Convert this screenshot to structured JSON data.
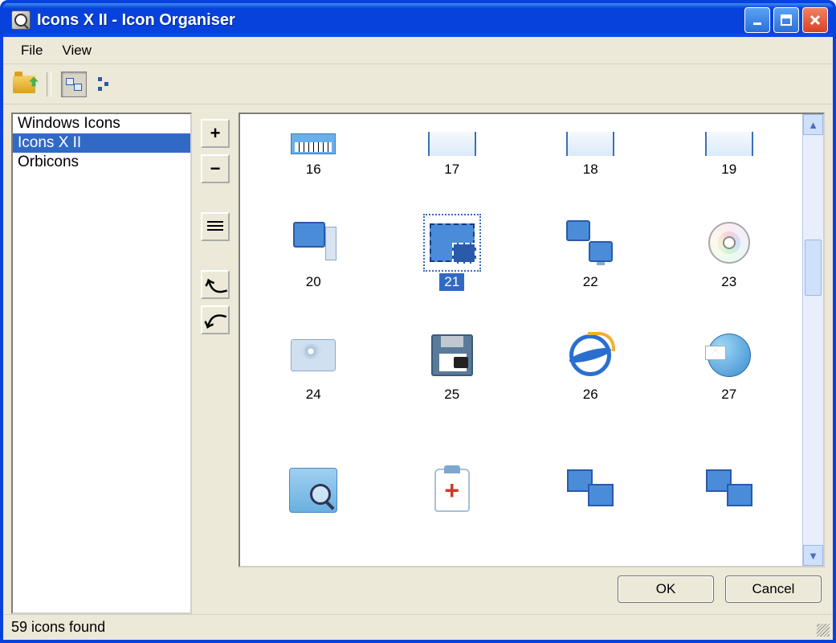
{
  "window": {
    "title": "Icons X II - Icon Organiser"
  },
  "menu": {
    "file": "File",
    "view": "View"
  },
  "sidebar": {
    "items": [
      {
        "label": "Windows Icons"
      },
      {
        "label": "Icons X II"
      },
      {
        "label": "Orbicons"
      }
    ],
    "selected_index": 1
  },
  "grid": {
    "selected_index": 5,
    "icons": [
      {
        "label": "16",
        "kind": "piano"
      },
      {
        "label": "17",
        "kind": "monitor"
      },
      {
        "label": "18",
        "kind": "monitor"
      },
      {
        "label": "19",
        "kind": "monitor"
      },
      {
        "label": "20",
        "kind": "computer"
      },
      {
        "label": "21",
        "kind": "network-selected"
      },
      {
        "label": "22",
        "kind": "network"
      },
      {
        "label": "23",
        "kind": "disc"
      },
      {
        "label": "24",
        "kind": "drive"
      },
      {
        "label": "25",
        "kind": "floppy"
      },
      {
        "label": "26",
        "kind": "ie"
      },
      {
        "label": "27",
        "kind": "globe-mail"
      },
      {
        "label": "",
        "kind": "magnify"
      },
      {
        "label": "",
        "kind": "med"
      },
      {
        "label": "",
        "kind": "screens"
      },
      {
        "label": "",
        "kind": "screens"
      }
    ]
  },
  "buttons": {
    "ok": "OK",
    "cancel": "Cancel"
  },
  "status": {
    "text": "59 icons found"
  }
}
